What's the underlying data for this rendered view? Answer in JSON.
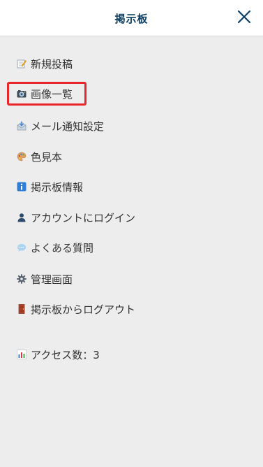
{
  "header": {
    "title": "掲示板",
    "close_label": "✕"
  },
  "menu": {
    "items": [
      {
        "label": "新規投稿",
        "icon": "memo-icon"
      },
      {
        "label": "画像一覧",
        "icon": "camera-icon"
      },
      {
        "label": "メール通知設定",
        "icon": "incoming-mail-icon"
      },
      {
        "label": "色見本",
        "icon": "palette-icon"
      },
      {
        "label": "掲示板情報",
        "icon": "info-icon"
      },
      {
        "label": "アカウントにログイン",
        "icon": "user-icon"
      },
      {
        "label": "よくある質問",
        "icon": "speech-bubble-icon"
      },
      {
        "label": "管理画面",
        "icon": "gear-icon"
      },
      {
        "label": "掲示板からログアウト",
        "icon": "door-icon"
      }
    ],
    "access_count": {
      "label": "アクセス数：3",
      "icon": "bar-chart-icon"
    }
  },
  "colors": {
    "header_title": "#0d3f63",
    "highlight": "#e8262c",
    "background": "#ededed"
  }
}
